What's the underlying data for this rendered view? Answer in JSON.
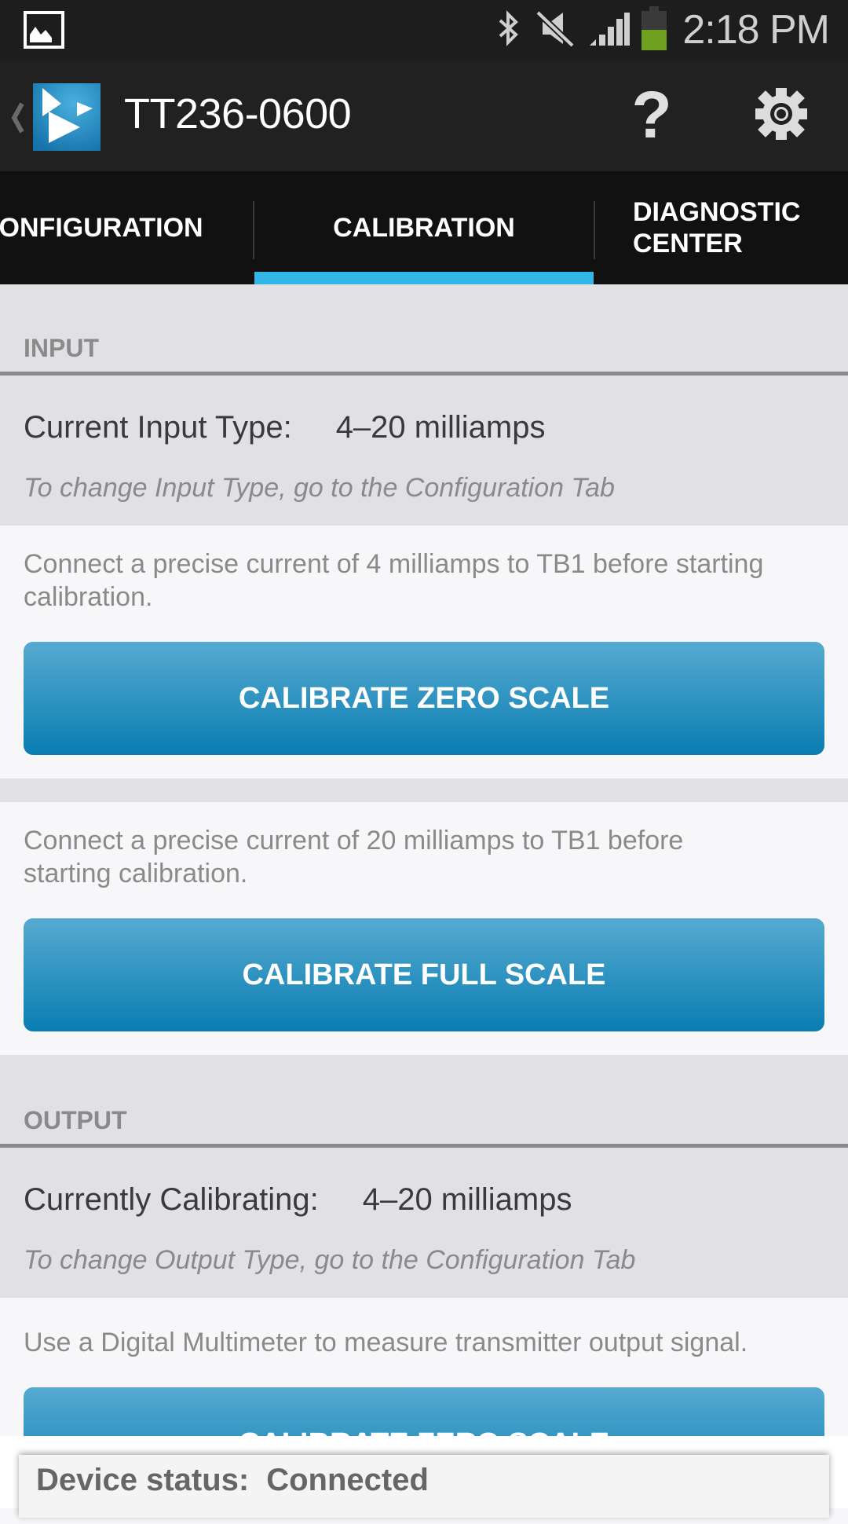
{
  "status_bar": {
    "time": "2:18 PM",
    "icons": [
      "gallery-notification-icon",
      "bluetooth-icon",
      "mute-icon",
      "signal-icon",
      "battery-icon"
    ],
    "battery_color": "#6fa020"
  },
  "action_bar": {
    "title": "TT236-0600",
    "help_label": "?",
    "accent_color": "#33b5e5"
  },
  "tabs": [
    {
      "label": "CONFIGURATION",
      "selected": false
    },
    {
      "label": "CALIBRATION",
      "selected": true
    },
    {
      "label": "DIAGNOSTIC CENTER",
      "selected": false
    }
  ],
  "input_section": {
    "header": "INPUT",
    "field_label": "Current Input Type:",
    "field_value": "4–20 milliamps",
    "hint": "To change Input Type, go to the Configuration Tab",
    "zero_card": {
      "instruction": "Connect a precise current of 4 milliamps to TB1 before starting calibration.",
      "button_label": "CALIBRATE ZERO SCALE"
    },
    "full_card": {
      "instruction": "Connect a precise current of 20 milliamps to TB1 before starting calibration.",
      "button_label": "CALIBRATE FULL SCALE"
    }
  },
  "output_section": {
    "header": "OUTPUT",
    "field_label": "Currently Calibrating:",
    "field_value": "4–20 milliamps",
    "hint": "To change Output Type, go to the Configuration Tab",
    "zero_card": {
      "instruction": "Use a Digital Multimeter to measure transmitter output signal.",
      "button_label": "CALIBRATE ZERO SCALE"
    }
  },
  "device_status": {
    "label": "Device status:",
    "value": "Connected"
  }
}
